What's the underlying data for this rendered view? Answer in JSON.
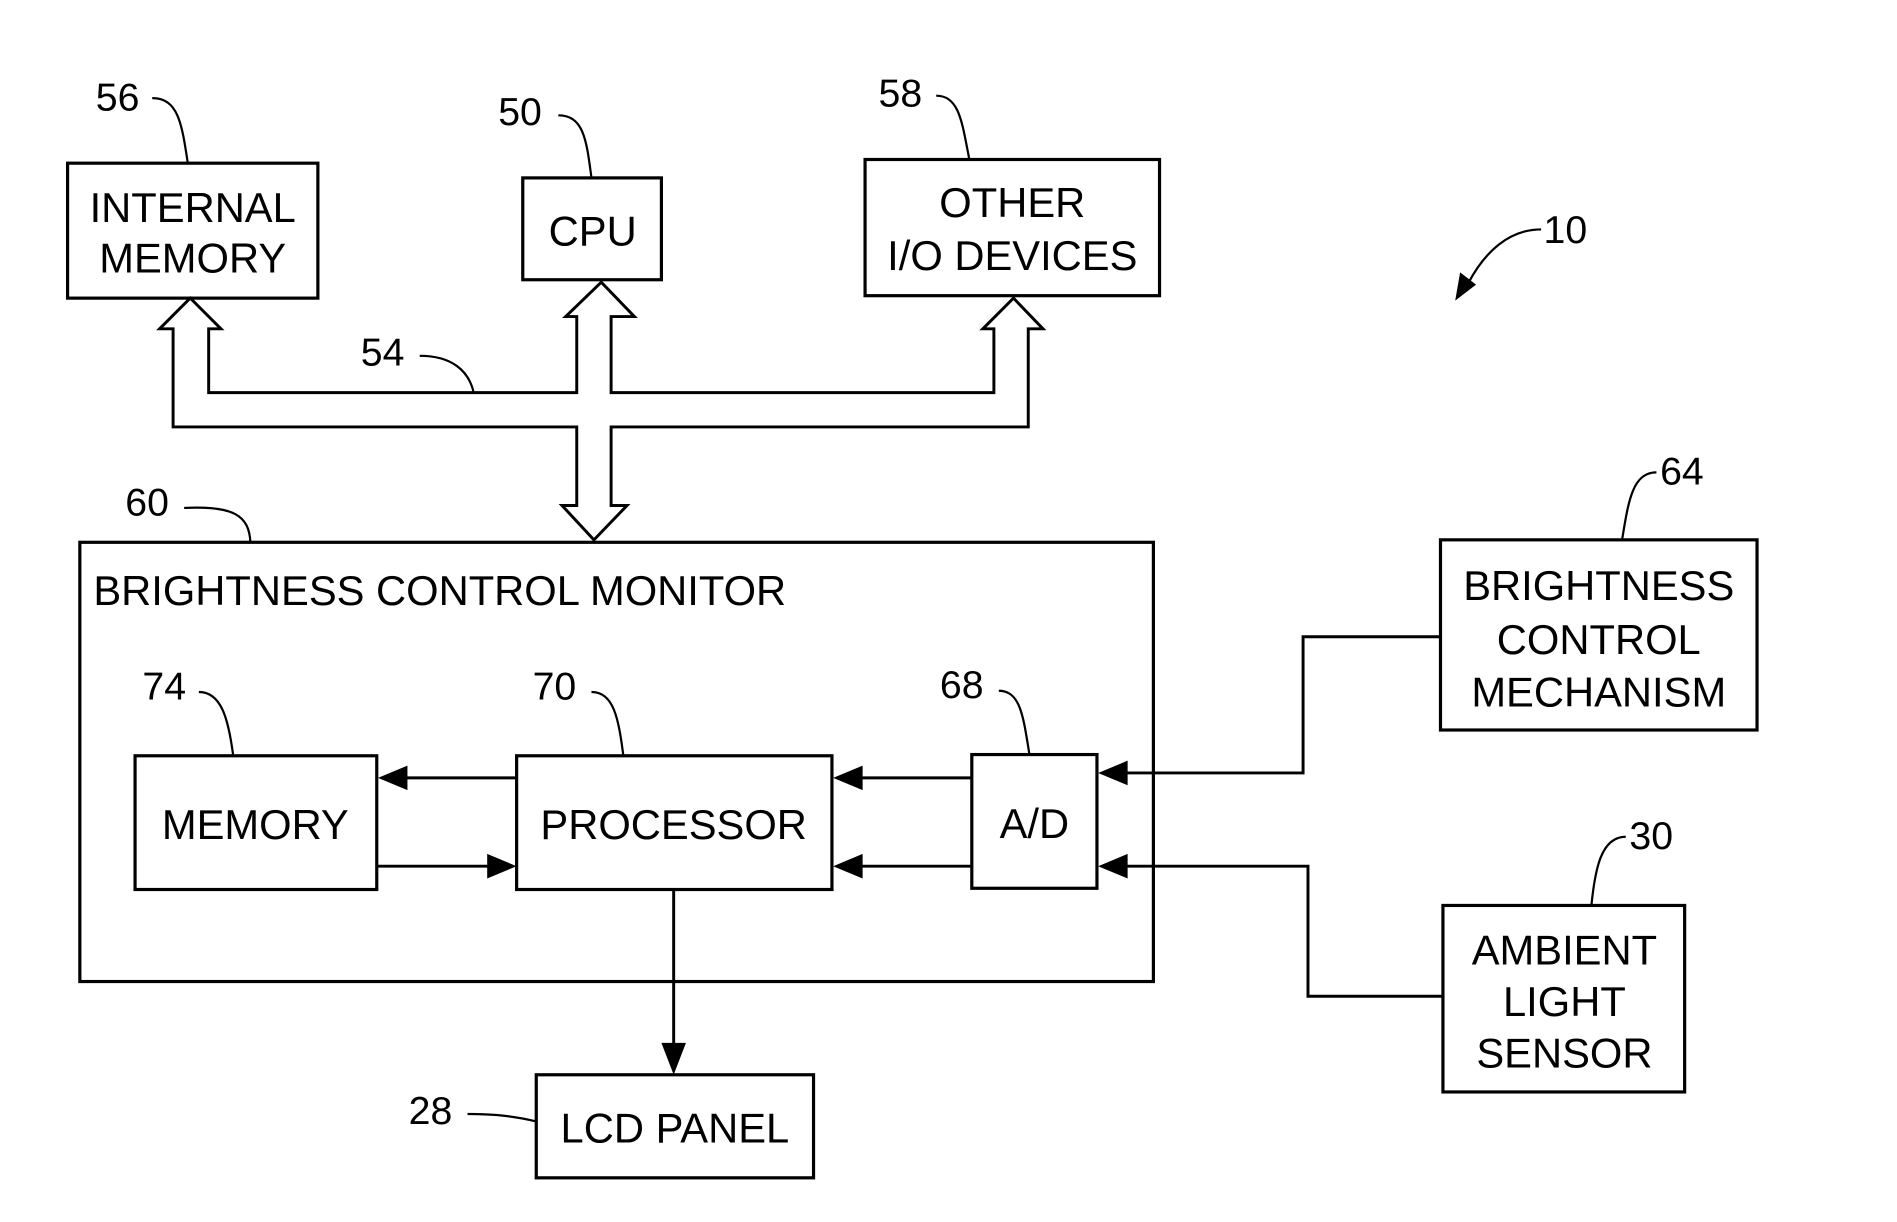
{
  "figure": {
    "ref_system": "10",
    "blocks": {
      "internal_memory": {
        "ref": "56",
        "lines": [
          "INTERNAL",
          "MEMORY"
        ]
      },
      "cpu": {
        "ref": "50",
        "lines": [
          "CPU"
        ]
      },
      "other_io": {
        "ref": "58",
        "lines": [
          "OTHER",
          "I/O DEVICES"
        ]
      },
      "bus": {
        "ref": "54"
      },
      "monitor": {
        "ref": "60",
        "title": "BRIGHTNESS CONTROL MONITOR"
      },
      "memory": {
        "ref": "74",
        "lines": [
          "MEMORY"
        ]
      },
      "processor": {
        "ref": "70",
        "lines": [
          "PROCESSOR"
        ]
      },
      "ad": {
        "ref": "68",
        "lines": [
          "A/D"
        ]
      },
      "brightness_mechanism": {
        "ref": "64",
        "lines": [
          "BRIGHTNESS",
          "CONTROL",
          "MECHANISM"
        ]
      },
      "ambient_sensor": {
        "ref": "30",
        "lines": [
          "AMBIENT",
          "LIGHT",
          "SENSOR"
        ]
      },
      "lcd_panel": {
        "ref": "28",
        "lines": [
          "LCD PANEL"
        ]
      }
    }
  }
}
